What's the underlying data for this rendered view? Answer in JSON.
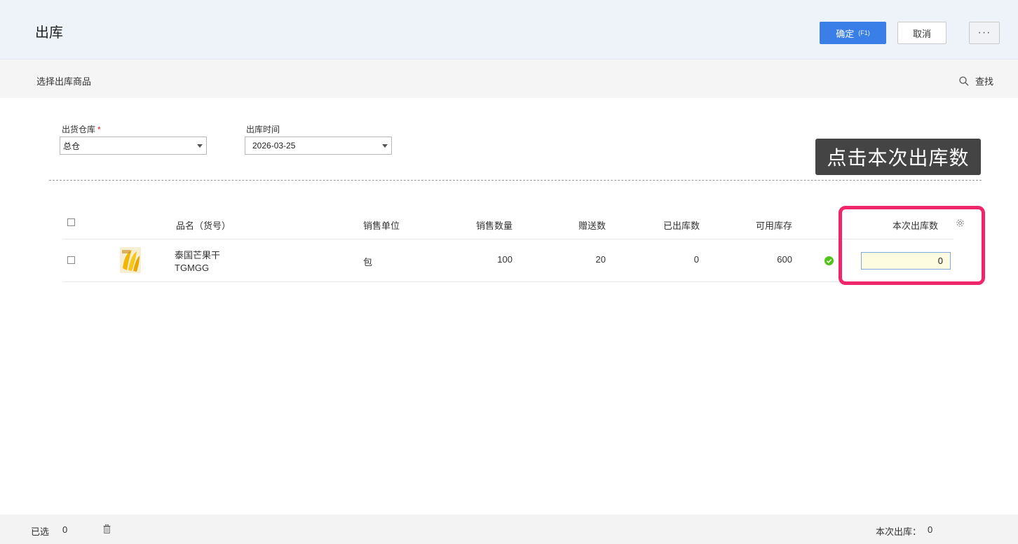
{
  "header": {
    "title": "出库",
    "confirm_label": "确定",
    "confirm_hint": "(F1)",
    "cancel_label": "取消",
    "more_label": "···"
  },
  "subbar": {
    "title": "选择出库商品",
    "find_label": "查找"
  },
  "form": {
    "warehouse_label": "出货仓库",
    "warehouse_required": "*",
    "warehouse_value": "总仓",
    "date_label": "出库时间",
    "date_value": "2026-03-25"
  },
  "tooltip": "点击本次出库数",
  "table": {
    "columns": {
      "name": "品名（货号）",
      "unit": "销售单位",
      "sale_qty": "销售数量",
      "gift_qty": "赠送数",
      "shipped_qty": "已出库数",
      "stock": "可用库存",
      "this_qty": "本次出库数"
    },
    "rows": [
      {
        "name": "泰国芒果干",
        "code": "TGMGG",
        "unit": "包",
        "sale_qty": "100",
        "gift_qty": "20",
        "shipped_qty": "0",
        "stock": "600",
        "this_qty": "0"
      }
    ]
  },
  "footer": {
    "selected_label": "已选",
    "selected_count": "0",
    "total_label": "本次出库：",
    "total_value": "0"
  },
  "colors": {
    "primary": "#3a7ee8",
    "highlight": "#f0266b",
    "status_ok": "#52c41a"
  }
}
